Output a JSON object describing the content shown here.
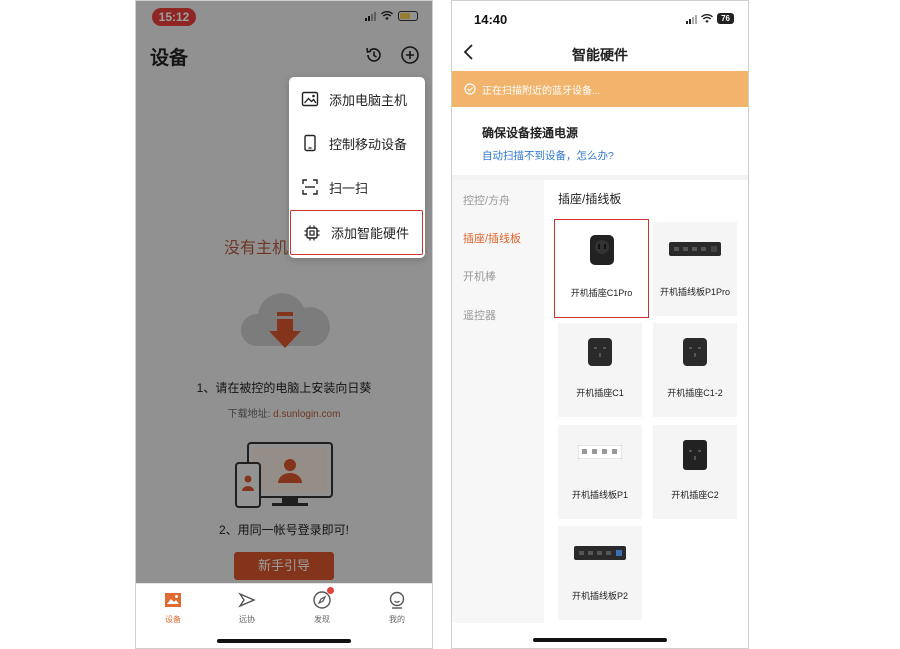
{
  "left": {
    "status_time": "15:12",
    "title": "设备",
    "menu": [
      {
        "label": "添加电脑主机",
        "icon": "image-icon"
      },
      {
        "label": "控制移动设备",
        "icon": "phone-icon"
      },
      {
        "label": "扫一扫",
        "icon": "scan-icon"
      },
      {
        "label": "添加智能硬件",
        "icon": "chip-icon",
        "highlighted": true
      }
    ],
    "empty_title": "没有主机",
    "step1": "1、请在被控的电脑上安装向日葵",
    "download_prefix": "下载地址:",
    "download_url": "d.sunlogin.com",
    "step2": "2、用同一帐号登录即可!",
    "guide_button": "新手引导",
    "tabs": [
      {
        "label": "设备",
        "icon": "device-icon",
        "active": true
      },
      {
        "label": "远协",
        "icon": "remote-icon",
        "active": false
      },
      {
        "label": "发现",
        "icon": "discover-icon",
        "active": false,
        "badge": true
      },
      {
        "label": "我的",
        "icon": "profile-icon",
        "active": false
      }
    ]
  },
  "right": {
    "status_time": "14:40",
    "battery": "76",
    "title": "智能硬件",
    "scan_text": "正在扫描附近的蓝牙设备...",
    "ensure_title": "确保设备接通电源",
    "help_link": "自动扫描不到设备，怎么办?",
    "categories": [
      {
        "label": "控控/方舟",
        "active": false
      },
      {
        "label": "插座/插线板",
        "active": true
      },
      {
        "label": "开机棒",
        "active": false
      },
      {
        "label": "遥控器",
        "active": false
      }
    ],
    "section_title": "插座/插线板",
    "products": [
      {
        "label": "开机插座C1Pro",
        "icon": "socket-c1pro-icon",
        "selected": true
      },
      {
        "label": "开机插线板P1Pro",
        "icon": "power-strip-p1pro-icon",
        "selected": false
      },
      {
        "label": "开机插座C1",
        "icon": "socket-c1-icon",
        "selected": false
      },
      {
        "label": "开机插座C1-2",
        "icon": "socket-c1-2-icon",
        "selected": false
      },
      {
        "label": "开机插线板P1",
        "icon": "power-strip-p1-icon",
        "selected": false
      },
      {
        "label": "开机插座C2",
        "icon": "socket-c2-icon",
        "selected": false
      },
      {
        "label": "开机插线板P2",
        "icon": "power-strip-p2-icon",
        "selected": false
      }
    ]
  },
  "colors": {
    "accent": "#e0642c",
    "highlight_border": "#d0312d",
    "scan_bar": "#f2b46c",
    "link": "#2e7ad1"
  }
}
